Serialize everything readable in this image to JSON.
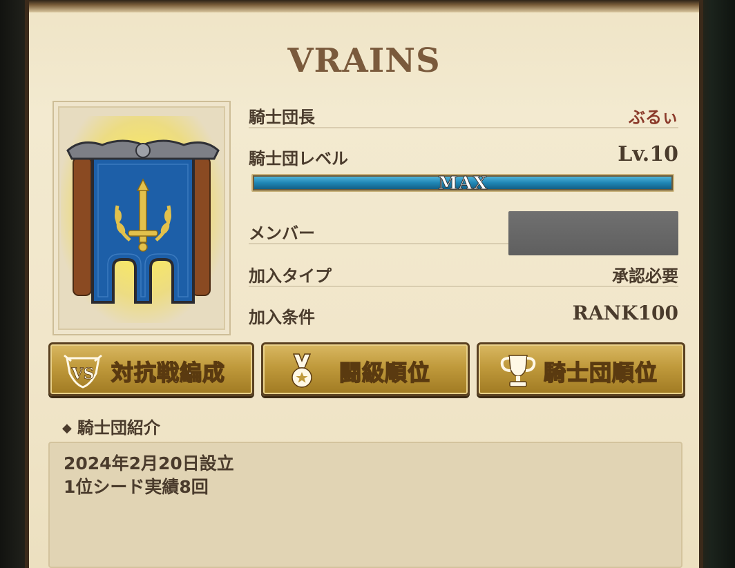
{
  "guild": {
    "name": "VRAINS",
    "emblem_icon": "guild-banner-sword-laurel"
  },
  "info": {
    "leader_label": "騎士団長",
    "leader_value": "ぶるぃ",
    "level_label": "騎士団レベル",
    "level_value": "Lv.10",
    "level_bar_text": "MAX",
    "level_progress": 1.0,
    "member_label": "メンバー",
    "join_type_label": "加入タイプ",
    "join_type_value": "承認必要",
    "join_cond_label": "加入条件",
    "join_cond_value": "RANK100"
  },
  "buttons": {
    "battle_formation": {
      "label": "対抗戦編成",
      "icon": "vs-crest-icon"
    },
    "rank_order": {
      "label": "闘級順位",
      "icon": "medal-icon"
    },
    "guild_ranking": {
      "label": "騎士団順位",
      "icon": "trophy-icon"
    }
  },
  "intro": {
    "heading": "騎士団紹介",
    "lines": [
      "2024年2月20日設立",
      "1位シード実績8回"
    ]
  },
  "colors": {
    "panel_bg": "#f1e6ca",
    "title": "#7a5a3c",
    "leader_name": "#8b3a2a",
    "level_bar": "#1f86b5",
    "button_gold": "#c09a3c"
  }
}
